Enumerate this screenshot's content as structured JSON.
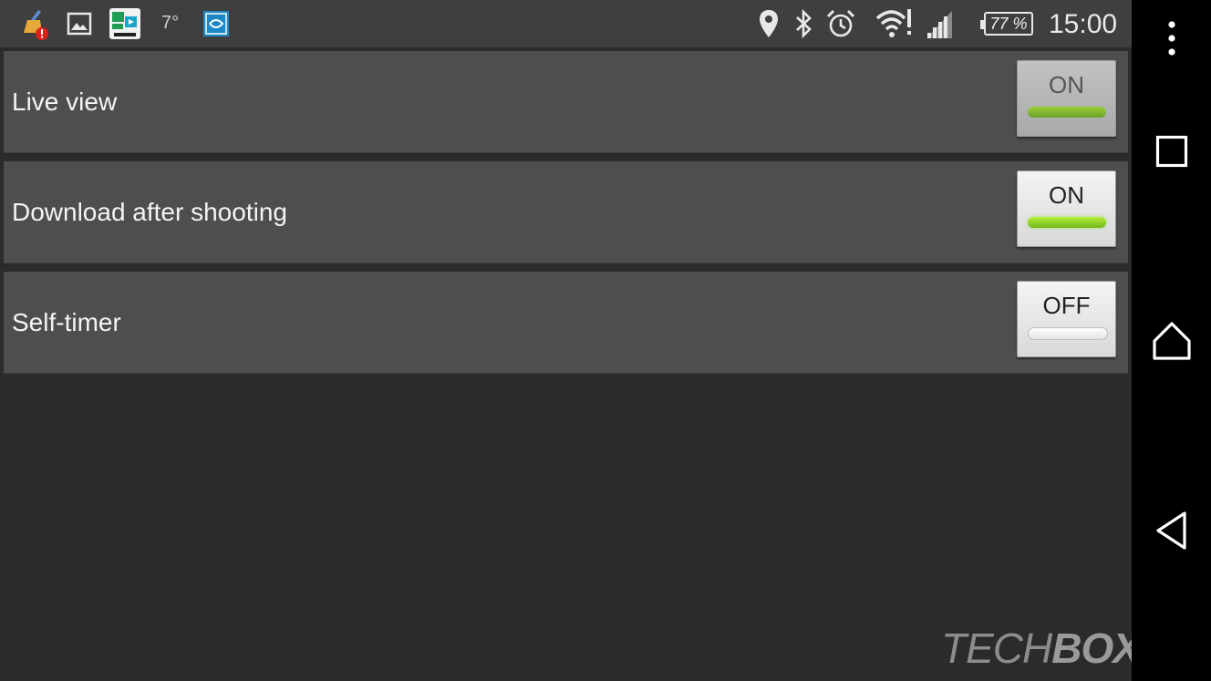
{
  "status_bar": {
    "temperature": "7°",
    "battery_percent": "77 %",
    "time": "15:00",
    "icons": [
      "cleaner-alert-icon",
      "gallery-icon",
      "nikon-app-icon",
      "temperature-text",
      "nfc-app-icon",
      "location-icon",
      "bluetooth-icon",
      "alarm-icon",
      "wifi-alert-icon",
      "cell-signal-icon",
      "battery-icon"
    ]
  },
  "settings": [
    {
      "label": "Live view",
      "toggle_text": "ON",
      "state": "on",
      "dimmed": true
    },
    {
      "label": "Download after shooting",
      "toggle_text": "ON",
      "state": "on",
      "dimmed": false
    },
    {
      "label": "Self-timer",
      "toggle_text": "OFF",
      "state": "off",
      "dimmed": false
    }
  ],
  "nav_bar": {
    "icons": [
      "more-options-icon",
      "recents-icon",
      "home-icon",
      "back-icon"
    ]
  },
  "watermark": {
    "text_light": "TECH",
    "text_bold": "BOX"
  },
  "colors": {
    "on_indicator": "#8fd32a",
    "row_bg": "#4e4e4e",
    "background": "#2b2b2b",
    "status_bar": "#3f3f3f"
  }
}
